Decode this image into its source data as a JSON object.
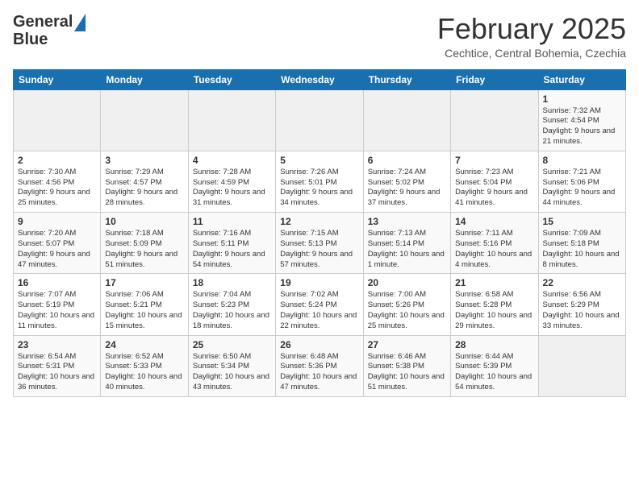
{
  "header": {
    "logo_line1": "General",
    "logo_line2": "Blue",
    "title": "February 2025",
    "subtitle": "Cechtice, Central Bohemia, Czechia"
  },
  "days_of_week": [
    "Sunday",
    "Monday",
    "Tuesday",
    "Wednesday",
    "Thursday",
    "Friday",
    "Saturday"
  ],
  "weeks": [
    [
      {
        "day": "",
        "info": ""
      },
      {
        "day": "",
        "info": ""
      },
      {
        "day": "",
        "info": ""
      },
      {
        "day": "",
        "info": ""
      },
      {
        "day": "",
        "info": ""
      },
      {
        "day": "",
        "info": ""
      },
      {
        "day": "1",
        "info": "Sunrise: 7:32 AM\nSunset: 4:54 PM\nDaylight: 9 hours and 21 minutes."
      }
    ],
    [
      {
        "day": "2",
        "info": "Sunrise: 7:30 AM\nSunset: 4:56 PM\nDaylight: 9 hours and 25 minutes."
      },
      {
        "day": "3",
        "info": "Sunrise: 7:29 AM\nSunset: 4:57 PM\nDaylight: 9 hours and 28 minutes."
      },
      {
        "day": "4",
        "info": "Sunrise: 7:28 AM\nSunset: 4:59 PM\nDaylight: 9 hours and 31 minutes."
      },
      {
        "day": "5",
        "info": "Sunrise: 7:26 AM\nSunset: 5:01 PM\nDaylight: 9 hours and 34 minutes."
      },
      {
        "day": "6",
        "info": "Sunrise: 7:24 AM\nSunset: 5:02 PM\nDaylight: 9 hours and 37 minutes."
      },
      {
        "day": "7",
        "info": "Sunrise: 7:23 AM\nSunset: 5:04 PM\nDaylight: 9 hours and 41 minutes."
      },
      {
        "day": "8",
        "info": "Sunrise: 7:21 AM\nSunset: 5:06 PM\nDaylight: 9 hours and 44 minutes."
      }
    ],
    [
      {
        "day": "9",
        "info": "Sunrise: 7:20 AM\nSunset: 5:07 PM\nDaylight: 9 hours and 47 minutes."
      },
      {
        "day": "10",
        "info": "Sunrise: 7:18 AM\nSunset: 5:09 PM\nDaylight: 9 hours and 51 minutes."
      },
      {
        "day": "11",
        "info": "Sunrise: 7:16 AM\nSunset: 5:11 PM\nDaylight: 9 hours and 54 minutes."
      },
      {
        "day": "12",
        "info": "Sunrise: 7:15 AM\nSunset: 5:13 PM\nDaylight: 9 hours and 57 minutes."
      },
      {
        "day": "13",
        "info": "Sunrise: 7:13 AM\nSunset: 5:14 PM\nDaylight: 10 hours and 1 minute."
      },
      {
        "day": "14",
        "info": "Sunrise: 7:11 AM\nSunset: 5:16 PM\nDaylight: 10 hours and 4 minutes."
      },
      {
        "day": "15",
        "info": "Sunrise: 7:09 AM\nSunset: 5:18 PM\nDaylight: 10 hours and 8 minutes."
      }
    ],
    [
      {
        "day": "16",
        "info": "Sunrise: 7:07 AM\nSunset: 5:19 PM\nDaylight: 10 hours and 11 minutes."
      },
      {
        "day": "17",
        "info": "Sunrise: 7:06 AM\nSunset: 5:21 PM\nDaylight: 10 hours and 15 minutes."
      },
      {
        "day": "18",
        "info": "Sunrise: 7:04 AM\nSunset: 5:23 PM\nDaylight: 10 hours and 18 minutes."
      },
      {
        "day": "19",
        "info": "Sunrise: 7:02 AM\nSunset: 5:24 PM\nDaylight: 10 hours and 22 minutes."
      },
      {
        "day": "20",
        "info": "Sunrise: 7:00 AM\nSunset: 5:26 PM\nDaylight: 10 hours and 25 minutes."
      },
      {
        "day": "21",
        "info": "Sunrise: 6:58 AM\nSunset: 5:28 PM\nDaylight: 10 hours and 29 minutes."
      },
      {
        "day": "22",
        "info": "Sunrise: 6:56 AM\nSunset: 5:29 PM\nDaylight: 10 hours and 33 minutes."
      }
    ],
    [
      {
        "day": "23",
        "info": "Sunrise: 6:54 AM\nSunset: 5:31 PM\nDaylight: 10 hours and 36 minutes."
      },
      {
        "day": "24",
        "info": "Sunrise: 6:52 AM\nSunset: 5:33 PM\nDaylight: 10 hours and 40 minutes."
      },
      {
        "day": "25",
        "info": "Sunrise: 6:50 AM\nSunset: 5:34 PM\nDaylight: 10 hours and 43 minutes."
      },
      {
        "day": "26",
        "info": "Sunrise: 6:48 AM\nSunset: 5:36 PM\nDaylight: 10 hours and 47 minutes."
      },
      {
        "day": "27",
        "info": "Sunrise: 6:46 AM\nSunset: 5:38 PM\nDaylight: 10 hours and 51 minutes."
      },
      {
        "day": "28",
        "info": "Sunrise: 6:44 AM\nSunset: 5:39 PM\nDaylight: 10 hours and 54 minutes."
      },
      {
        "day": "",
        "info": ""
      }
    ]
  ]
}
